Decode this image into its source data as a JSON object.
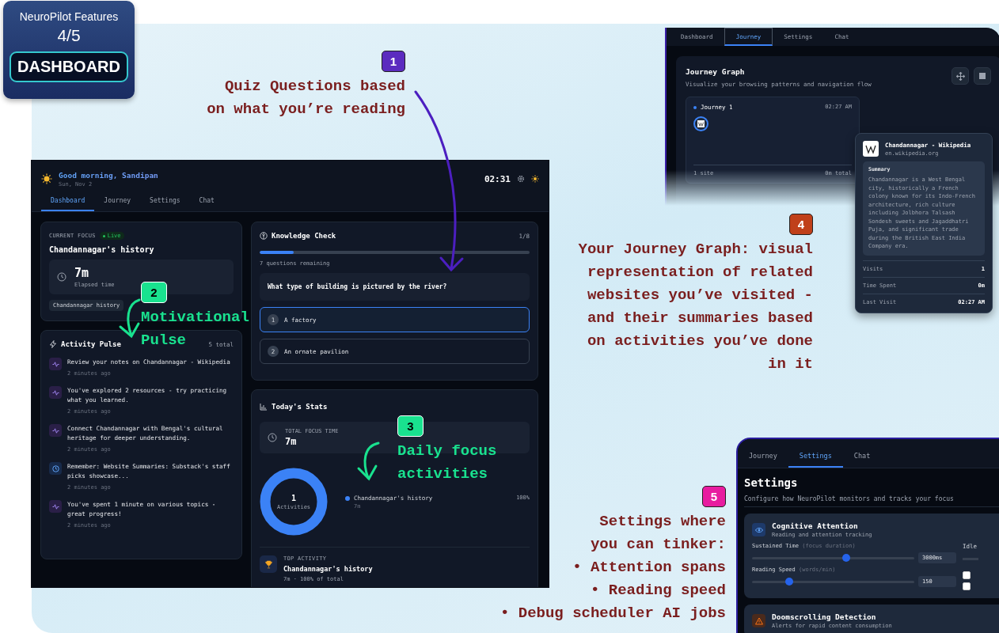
{
  "badge": {
    "title": "NeuroPilot Features",
    "counter": "4/5",
    "label": "DASHBOARD"
  },
  "callouts": [
    {
      "number": "1",
      "color": "#5b2bbf",
      "kind": "caption",
      "lines": [
        "Quiz Questions based",
        "on what you’re reading"
      ]
    },
    {
      "number": "2",
      "color": "#19e28f",
      "kind": "overlay",
      "lines": [
        "Motivational",
        "Pulse"
      ]
    },
    {
      "number": "3",
      "color": "#19e28f",
      "kind": "overlay",
      "lines": [
        "Daily focus",
        "activities"
      ]
    },
    {
      "number": "4",
      "color": "#c0401a",
      "kind": "caption",
      "lines": [
        "Your Journey Graph: visual",
        "representation of related",
        "websites you’ve visited -",
        "and their summaries based",
        "on activities you’ve done",
        "in it"
      ]
    },
    {
      "number": "5",
      "color": "#e81ca0",
      "kind": "caption",
      "lines": [
        "Settings where",
        "you can tinker:",
        "• Attention spans",
        "• Reading speed",
        "• Debug scheduler AI jobs"
      ]
    }
  ],
  "dashboard": {
    "greeting": "Good morning, Sandipan",
    "date": "Sun, Nov 2",
    "time": "02:31",
    "tabs": [
      {
        "label": "Dashboard",
        "selected": true
      },
      {
        "label": "Journey",
        "selected": false
      },
      {
        "label": "Settings",
        "selected": false
      },
      {
        "label": "Chat",
        "selected": false
      }
    ],
    "current_focus": {
      "label": "CURRENT FOCUS",
      "badge": "Live",
      "title": "Chandannagar's history",
      "elapsed": "7m",
      "elapsed_label": "Elapsed time",
      "tag": "Chandannagar history"
    },
    "activity_pulse": {
      "title": "Activity Pulse",
      "count": "5 total",
      "items": [
        {
          "kind": "pulse",
          "text": "Review your notes on Chandannagar - Wikipedia",
          "time": "2 minutes ago"
        },
        {
          "kind": "pulse",
          "text": "You've explored 2 resources - try practicing what you learned.",
          "time": "2 minutes ago"
        },
        {
          "kind": "pulse",
          "text": "Connect Chandannagar with Bengal's cultural heritage for deeper understanding.",
          "time": "2 minutes ago"
        },
        {
          "kind": "reminder",
          "text": "Remember: Website Summaries: Substack's staff picks showcase...",
          "time": "2 minutes ago"
        },
        {
          "kind": "pulse",
          "text": "You've spent 1 minute on various topics - great progress!",
          "time": "2 minutes ago"
        }
      ]
    },
    "knowledge_check": {
      "title": "Knowledge Check",
      "counter": "1/8",
      "level": 0.125,
      "remaining": "7 questions remaining",
      "question": "What type of building is pictured by the river?",
      "options": [
        {
          "number": "1",
          "text": "A factory",
          "selected": true
        },
        {
          "number": "2",
          "text": "An ornate pavilion",
          "selected": false
        }
      ]
    },
    "todays_stats": {
      "title": "Today's Stats",
      "total_label": "TOTAL FOCUS TIME",
      "total": "7m",
      "center_value": "1",
      "center_label": "Activities",
      "legend": [
        {
          "name": "Chandannagar's history",
          "time": "7m",
          "percent": "100%",
          "color": "#3b82f6"
        }
      ],
      "top_label": "TOP ACTIVITY",
      "top_name": "Chandannagar's history",
      "top_detail": "7m · 100% of total"
    }
  },
  "journey": {
    "tabs": [
      {
        "label": "Dashboard",
        "selected": false
      },
      {
        "label": "Journey",
        "selected": true
      },
      {
        "label": "Settings",
        "selected": false
      },
      {
        "label": "Chat",
        "selected": false
      }
    ],
    "title": "Journey Graph",
    "subtitle": "Visualize your browsing patterns and navigation flow",
    "card": {
      "name": "Journey 1",
      "time": "02:27 AM",
      "sites": "1 site",
      "total": "0m total"
    },
    "popup": {
      "title": "Chandannagar - Wikipedia",
      "domain": "en.wikipedia.org",
      "summary_label": "Summary",
      "summary": "Chandannagar is a West Bengal city, historically a French colony known for its Indo-French architecture, rich culture including Jolbhora Talsash Sondesh sweets and Jagaddhatri Puja, and significant trade during the British East India Company era.",
      "stats": [
        {
          "label": "Visits",
          "value": "1"
        },
        {
          "label": "Time Spent",
          "value": "0m"
        },
        {
          "label": "Last Visit",
          "value": "02:27 AM"
        }
      ]
    }
  },
  "settings": {
    "tabs": [
      {
        "label": "Journey",
        "selected": false
      },
      {
        "label": "Settings",
        "selected": true
      },
      {
        "label": "Chat",
        "selected": false
      }
    ],
    "title": "Settings",
    "subtitle": "Configure how NeuroPilot monitors and tracks your focus",
    "cards": [
      {
        "kind": "sliders",
        "title": "Cognitive Attention",
        "subtitle": "Reading and attention tracking",
        "sliders": [
          {
            "label": "Sustained Time",
            "hint": "(focus duration)",
            "level": 0.58,
            "value": "3000ms"
          },
          {
            "label": "Reading Speed",
            "hint": "(words/min)",
            "level": 0.23,
            "value": "150"
          }
        ],
        "side_label": "Idle",
        "checkboxes": [
          {
            "checked": false
          },
          {
            "checked": false
          }
        ]
      },
      {
        "kind": "warning",
        "title": "Doomscrolling Detection",
        "subtitle": "Alerts for rapid content consumption"
      }
    ]
  }
}
